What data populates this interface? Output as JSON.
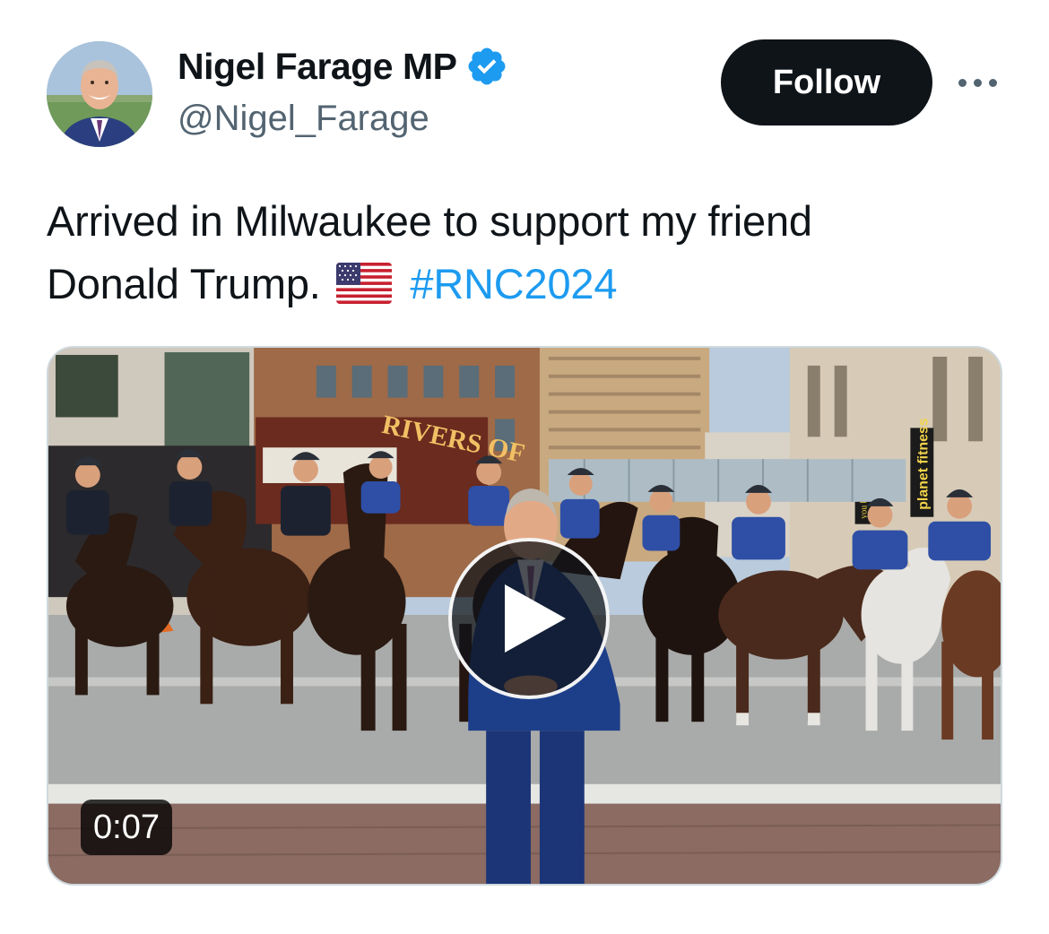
{
  "author": {
    "display_name": "Nigel Farage MP",
    "handle": "@Nigel_Farage",
    "verified": true
  },
  "follow_button": {
    "label": "Follow"
  },
  "more_button": {
    "icon": "more-horizontal-icon"
  },
  "tweet": {
    "text_line1": "Arrived in Milwaukee to support my friend",
    "text_line2": "Donald Trump.",
    "emoji": "us-flag-icon",
    "hashtag": "#RNC2024"
  },
  "media": {
    "type": "video",
    "duration": "0:07",
    "play_icon": "play-icon",
    "signs": {
      "theater": "RIVERS OF",
      "gym": "planet fitness",
      "gym_small": "you belong!"
    }
  },
  "colors": {
    "text": "#0f1419",
    "secondary": "#536471",
    "link": "#1d9bf0",
    "verified": "#1d9bf0",
    "follow_bg": "#0f1419"
  }
}
